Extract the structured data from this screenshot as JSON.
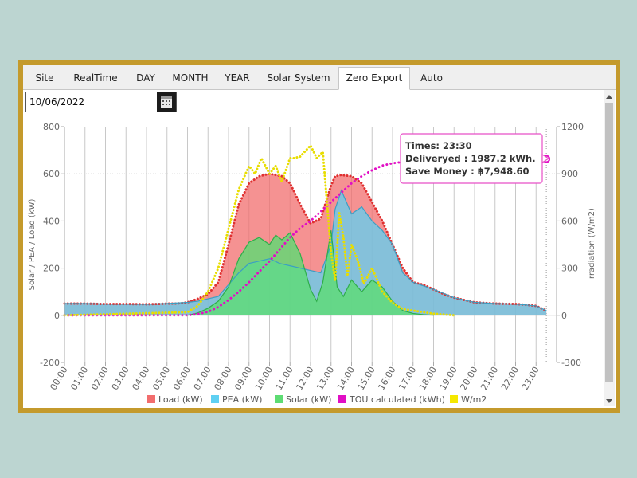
{
  "tabs": [
    {
      "label": "Site",
      "active": false
    },
    {
      "label": "RealTime",
      "active": false
    },
    {
      "label": "DAY",
      "active": false
    },
    {
      "label": "MONTH",
      "active": false
    },
    {
      "label": "YEAR",
      "active": false
    },
    {
      "label": "Solar System",
      "active": false
    },
    {
      "label": "Zero Export",
      "active": true
    },
    {
      "label": "Auto",
      "active": false
    }
  ],
  "date_field": {
    "value": "10/06/2022"
  },
  "tooltip": {
    "line1": "Times: 23:30",
    "line2": "Deliveryed : 1987.2 kWh.",
    "line3": "Save Money : ฿7,948.60"
  },
  "chart_data": {
    "type": "area",
    "ylabel": "Solar / PEA / Load (kW)",
    "y2label": "Irradiation (W/m2)",
    "ylim": [
      -200,
      800
    ],
    "y2lim": [
      -300,
      1200
    ],
    "yticks": [
      -200,
      0,
      200,
      400,
      600,
      800
    ],
    "y2ticks": [
      -300,
      0,
      300,
      600,
      900,
      1200
    ],
    "xlim": [
      0,
      24
    ],
    "xticks": [
      "00:00",
      "01:00",
      "02:00",
      "03:00",
      "04:00",
      "05:00",
      "06:00",
      "07:00",
      "08:00",
      "09:00",
      "10:00",
      "11:00",
      "12:00",
      "13:00",
      "14:00",
      "15:00",
      "16:00",
      "17:00",
      "18:00",
      "19:00",
      "20:00",
      "21:00",
      "22:00",
      "23:00"
    ],
    "grid": "vertical",
    "legend_position": "bottom",
    "colors": {
      "load": "#f26d6d",
      "pea": "#5fd0f2",
      "solar": "#5ddc73",
      "tou": "#e10fc4",
      "wm2": "#f5e800"
    },
    "series": [
      {
        "name": "Load (kW)",
        "axis": "left",
        "x": [
          0,
          0.5,
          1,
          2,
          3,
          4,
          4.5,
          5,
          5.5,
          6,
          6.5,
          7,
          7.5,
          8,
          8.5,
          9,
          9.5,
          10,
          10.3,
          10.6,
          11,
          11.5,
          12,
          12.5,
          13,
          13.2,
          13.5,
          14,
          14.5,
          15,
          15.5,
          16,
          16.5,
          17,
          17.5,
          18,
          18.5,
          19,
          20,
          21,
          22,
          22.5,
          23,
          23.5
        ],
        "values": [
          50,
          50,
          50,
          48,
          48,
          47,
          48,
          50,
          50,
          55,
          70,
          90,
          140,
          300,
          470,
          560,
          590,
          600,
          595,
          590,
          560,
          470,
          390,
          410,
          550,
          590,
          595,
          590,
          560,
          480,
          400,
          300,
          200,
          140,
          130,
          110,
          90,
          75,
          55,
          50,
          48,
          45,
          40,
          20
        ]
      },
      {
        "name": "PEA (kW)",
        "axis": "left",
        "x": [
          0,
          1,
          2,
          3,
          4,
          5,
          6,
          6.5,
          7,
          7.5,
          8,
          8.5,
          9,
          9.5,
          10,
          10.5,
          11,
          11.5,
          12,
          12.5,
          13,
          13.2,
          13.5,
          14,
          14.5,
          15,
          15.5,
          16,
          16.5,
          17,
          18,
          19,
          20,
          21,
          22,
          23,
          23.5
        ],
        "values": [
          50,
          50,
          48,
          48,
          47,
          50,
          55,
          60,
          70,
          80,
          130,
          180,
          220,
          230,
          240,
          220,
          210,
          200,
          190,
          180,
          300,
          450,
          530,
          430,
          460,
          400,
          360,
          300,
          180,
          140,
          110,
          75,
          55,
          50,
          48,
          40,
          20
        ]
      },
      {
        "name": "Solar (kW)",
        "axis": "left",
        "x": [
          6,
          6.5,
          7,
          7.5,
          8,
          8.5,
          9,
          9.5,
          10,
          10.3,
          10.6,
          11,
          11.5,
          12,
          12.3,
          12.6,
          13,
          13.3,
          13.6,
          14,
          14.5,
          15,
          15.5,
          16,
          16.5,
          17,
          17.5,
          18
        ],
        "values": [
          0,
          10,
          30,
          60,
          120,
          240,
          310,
          330,
          300,
          340,
          320,
          350,
          260,
          110,
          60,
          140,
          360,
          120,
          80,
          150,
          100,
          150,
          120,
          60,
          20,
          8,
          3,
          0
        ]
      },
      {
        "name": "TOU calculated (kWh)",
        "axis": "left",
        "x": [
          0,
          1,
          2,
          3,
          4,
          5,
          5.5,
          6,
          6.5,
          7,
          7.5,
          8,
          8.5,
          9,
          9.5,
          10,
          10.5,
          11,
          11.5,
          12,
          12.5,
          13,
          13.5,
          14,
          14.5,
          15,
          15.5,
          16,
          16.5,
          17,
          18,
          19,
          20,
          21,
          22,
          23,
          23.5
        ],
        "values": [
          0,
          0,
          0,
          0,
          0,
          0,
          0,
          0,
          5,
          15,
          35,
          65,
          100,
          140,
          185,
          230,
          280,
          330,
          370,
          400,
          440,
          480,
          520,
          560,
          590,
          615,
          635,
          645,
          650,
          652,
          655,
          657,
          658,
          660,
          661,
          662,
          663
        ]
      },
      {
        "name": "W/m2",
        "axis": "right",
        "x": [
          0,
          6,
          6.5,
          7,
          7.5,
          8,
          8.5,
          9,
          9.3,
          9.6,
          10,
          10.3,
          10.6,
          11,
          11.2,
          11.5,
          12,
          12.3,
          12.6,
          13,
          13.2,
          13.4,
          13.6,
          13.8,
          14,
          14.3,
          14.6,
          15,
          15.5,
          16,
          16.5,
          17,
          17.5,
          18,
          18.5,
          19
        ],
        "values": [
          0,
          20,
          60,
          150,
          300,
          550,
          800,
          950,
          900,
          1000,
          900,
          950,
          850,
          1000,
          1000,
          1010,
          1080,
          1000,
          1040,
          400,
          220,
          650,
          500,
          250,
          450,
          350,
          200,
          300,
          150,
          80,
          40,
          30,
          20,
          10,
          5,
          0
        ]
      }
    ],
    "tooltip_marker": {
      "x": 23.5,
      "series": "TOU calculated (kWh)"
    }
  }
}
